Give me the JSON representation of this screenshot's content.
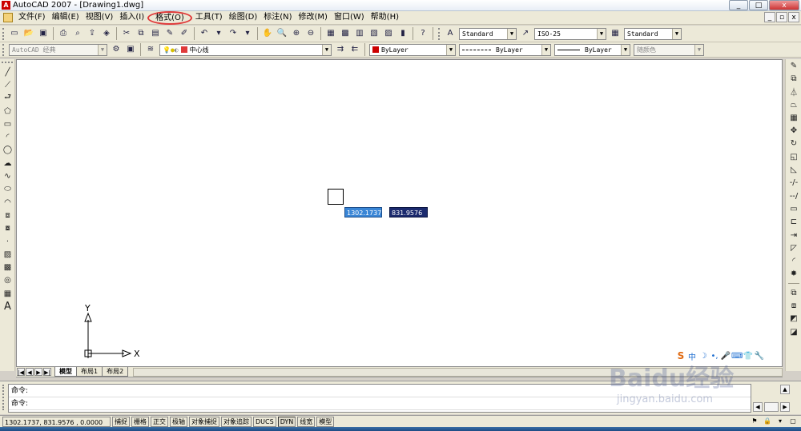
{
  "window": {
    "title": "AutoCAD 2007 - [Drawing1.dwg]",
    "app_icon": "A",
    "controls": [
      "_",
      "□",
      "x"
    ],
    "mdi_controls": [
      "_",
      "▫",
      "x"
    ]
  },
  "menu": {
    "items": [
      "文件(F)",
      "编辑(E)",
      "视图(V)",
      "插入(I)",
      "格式(O)",
      "工具(T)",
      "绘图(D)",
      "标注(N)",
      "修改(M)",
      "窗口(W)",
      "帮助(H)"
    ],
    "highlighted_index": 4
  },
  "toolbar1": {
    "text_style": "Standard",
    "dim_style": "ISO-25",
    "table_style": "Standard"
  },
  "toolbar2": {
    "workspace": "AutoCAD 经典",
    "layer": "中心线",
    "color": "ByLayer",
    "linetype": "ByLayer",
    "lineweight": "ByLayer",
    "plotstyle": "随颜色"
  },
  "canvas": {
    "tooltip_x": "1302.1737",
    "tooltip_y": "831.9576",
    "ucs_x": "X",
    "ucs_y": "Y"
  },
  "layout_tabs": [
    "模型",
    "布局1",
    "布局2"
  ],
  "command": {
    "line1": "命令:",
    "line2": "命令:"
  },
  "status": {
    "coords": "1302.1737, 831.9576 , 0.0000",
    "buttons": [
      "捕捉",
      "栅格",
      "正交",
      "极轴",
      "对象捕捉",
      "对象追踪",
      "DUCS",
      "DYN",
      "线宽",
      "模型"
    ]
  },
  "ime": {
    "label": "中"
  },
  "watermark": {
    "main": "Baidu经验",
    "url": "jingyan.baidu.com"
  },
  "colors": {
    "accent_red": "#e03a3a",
    "tooltip_x_bg": "#3a86d6",
    "tooltip_y_bg": "#1b2a6e"
  }
}
